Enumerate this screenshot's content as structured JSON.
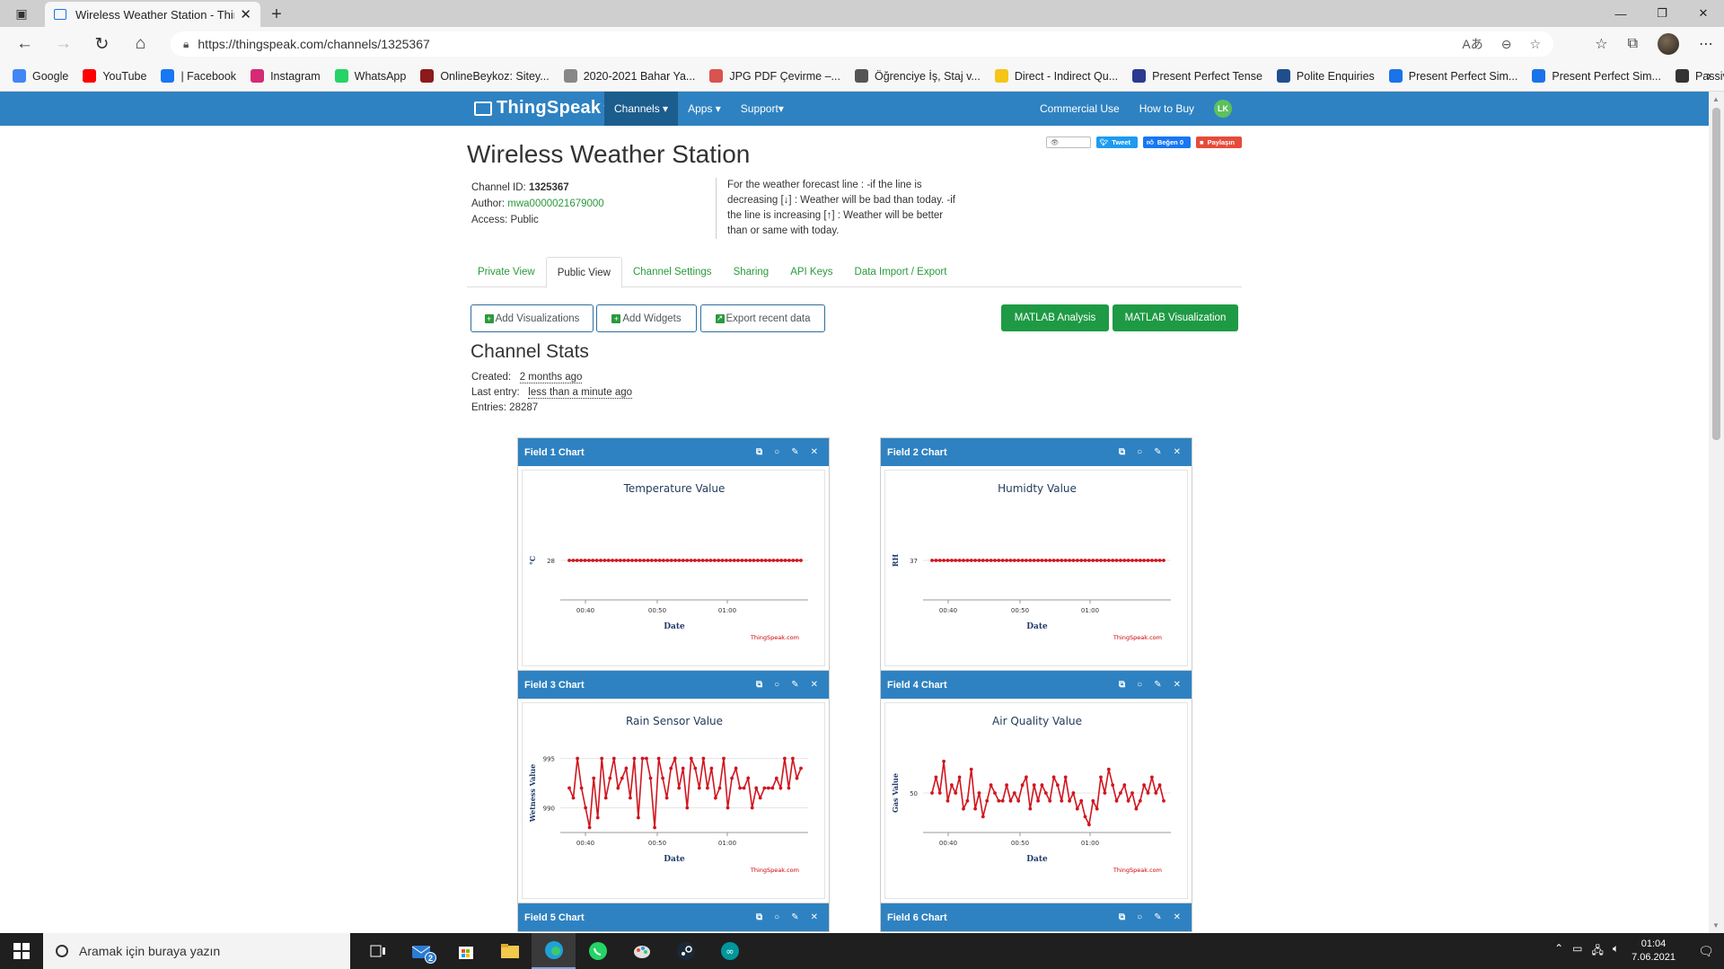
{
  "browser": {
    "tab_title": "Wireless Weather Station - Thing",
    "url": "https://thingspeak.com/channels/1325367",
    "bookmarks": [
      {
        "label": "Google",
        "icon": "google-icon",
        "color": "#4285f4"
      },
      {
        "label": "YouTube",
        "icon": "youtube-icon",
        "color": "#ff0000"
      },
      {
        "label": "| Facebook",
        "icon": "facebook-icon",
        "color": "#1877f2"
      },
      {
        "label": "Instagram",
        "icon": "instagram-icon",
        "color": "#d62976"
      },
      {
        "label": "WhatsApp",
        "icon": "whatsapp-icon",
        "color": "#25d366"
      },
      {
        "label": "OnlineBeykoz: Sitey...",
        "icon": "onlinebeykoz-icon",
        "color": "#8b1a1a"
      },
      {
        "label": "2020-2021 Bahar Ya...",
        "icon": "document-icon",
        "color": "#888888"
      },
      {
        "label": "JPG PDF Çevirme –...",
        "icon": "jpgpdf-icon",
        "color": "#d9534f"
      },
      {
        "label": "Öğrenciye İş, Staj v...",
        "icon": "ogrenci-icon",
        "color": "#555555"
      },
      {
        "label": "Direct - Indirect Qu...",
        "icon": "chat-icon",
        "color": "#f5c518"
      },
      {
        "label": "Present Perfect Tense",
        "icon": "ln-icon",
        "color": "#2b3990"
      },
      {
        "label": "Polite Enquiries",
        "icon": "polite-icon",
        "color": "#1f4e8c"
      },
      {
        "label": "Present Perfect Sim...",
        "icon": "c-icon",
        "color": "#1a73e8"
      },
      {
        "label": "Present Perfect Sim...",
        "icon": "c-icon",
        "color": "#1a73e8"
      },
      {
        "label": "Passive",
        "icon": "passive-icon",
        "color": "#333333"
      }
    ]
  },
  "nav": {
    "logo": "ThingSpeak",
    "tm": "™",
    "menu": [
      "Channels",
      "Apps",
      "Support"
    ],
    "right": [
      "Commercial Use",
      "How to Buy"
    ],
    "avatar": "LK"
  },
  "channel": {
    "title": "Wireless Weather Station",
    "social": [
      "Watch",
      "Tweet",
      "Beğen 0",
      "Paylaşın"
    ],
    "id_label": "Channel ID:",
    "id": "1325367",
    "author_label": "Author:",
    "author": "mwa0000021679000",
    "access": "Access: Public",
    "description": "For the weather forecast line : -if the line is decreasing [↓] : Weather will be bad than today. -if the line is increasing [↑] : Weather will be better than or same with today.",
    "tabs": [
      "Private View",
      "Public View",
      "Channel Settings",
      "Sharing",
      "API Keys",
      "Data Import / Export"
    ],
    "buttons": {
      "add_viz": "Add Visualizations",
      "add_widgets": "Add Widgets",
      "export": "Export recent data",
      "matlab_analysis": "MATLAB Analysis",
      "matlab_viz": "MATLAB Visualization"
    }
  },
  "stats": {
    "heading": "Channel Stats",
    "created_label": "Created:",
    "created": "2 months ago",
    "last_label": "Last entry:",
    "last": "less than a minute ago",
    "entries": "Entries: 28287"
  },
  "cards": [
    {
      "header": "Field 1 Chart"
    },
    {
      "header": "Field 2 Chart"
    },
    {
      "header": "Field 3 Chart"
    },
    {
      "header": "Field 4 Chart"
    },
    {
      "header": "Field 5 Chart"
    },
    {
      "header": "Field 6 Chart"
    }
  ],
  "chart_data": [
    {
      "type": "line",
      "title": "Temperature Value",
      "xlabel": "Date",
      "ylabel": "°C",
      "x_ticks": [
        "00:40",
        "00:50",
        "01:00"
      ],
      "y_ticks": [
        "28"
      ],
      "ylim": [
        27,
        29
      ],
      "credit": "ThingSpeak.com",
      "series": [
        {
          "values": [
            28,
            28,
            28,
            28,
            28,
            28,
            28,
            28,
            28,
            28,
            28,
            28,
            28,
            28,
            28,
            28,
            28,
            28,
            28,
            28,
            28,
            28,
            28,
            28,
            28,
            28,
            28,
            28,
            28,
            28,
            28,
            28,
            28,
            28,
            28,
            28,
            28,
            28,
            28,
            28,
            28,
            28,
            28,
            28,
            28,
            28,
            28,
            28,
            28,
            28,
            28,
            28,
            28,
            28,
            28,
            28,
            28,
            28,
            28,
            28
          ]
        }
      ]
    },
    {
      "type": "line",
      "title": "Humidty Value",
      "xlabel": "Date",
      "ylabel": "RH",
      "x_ticks": [
        "00:40",
        "00:50",
        "01:00"
      ],
      "y_ticks": [
        "37"
      ],
      "ylim": [
        36,
        38
      ],
      "credit": "ThingSpeak.com",
      "series": [
        {
          "values": [
            37,
            37,
            37,
            37,
            37,
            37,
            37,
            37,
            37,
            37,
            37,
            37,
            37,
            37,
            37,
            37,
            37,
            37,
            37,
            37,
            37,
            37,
            37,
            37,
            37,
            37,
            37,
            37,
            37,
            37,
            37,
            37,
            37,
            37,
            37,
            37,
            37,
            37,
            37,
            37,
            37,
            37,
            37,
            37,
            37,
            37,
            37,
            37,
            37,
            37,
            37,
            37,
            37,
            37,
            37,
            37,
            37,
            37,
            37,
            37
          ]
        }
      ]
    },
    {
      "type": "line",
      "title": "Rain Sensor Value",
      "xlabel": "Date",
      "ylabel": "Wetness Value",
      "x_ticks": [
        "00:40",
        "00:50",
        "01:00"
      ],
      "y_ticks": [
        "995",
        "990"
      ],
      "ylim": [
        987.5,
        995.5
      ],
      "credit": "ThingSpeak.com",
      "series": [
        {
          "values": [
            992,
            991,
            995,
            992,
            990,
            988,
            993,
            989,
            995,
            991,
            993,
            995,
            992,
            993,
            994,
            991,
            995,
            989,
            995,
            995,
            993,
            988,
            995,
            993,
            991,
            994,
            995,
            992,
            994,
            990,
            995,
            994,
            992,
            995,
            992,
            994,
            991,
            992,
            995,
            990,
            993,
            994,
            992,
            992,
            993,
            990,
            992,
            991,
            992,
            992,
            992,
            993,
            992,
            995,
            992,
            995,
            993,
            994
          ]
        }
      ]
    },
    {
      "type": "line",
      "title": "Air Quality Value",
      "xlabel": "Date",
      "ylabel": "Gas Value",
      "x_ticks": [
        "00:40",
        "00:50",
        "01:00"
      ],
      "y_ticks": [
        "50"
      ],
      "ylim": [
        45,
        55
      ],
      "credit": "ThingSpeak.com",
      "series": [
        {
          "values": [
            50,
            52,
            50,
            54,
            49,
            51,
            50,
            52,
            48,
            49,
            53,
            48,
            50,
            47,
            49,
            51,
            50,
            49,
            49,
            51,
            49,
            50,
            49,
            51,
            52,
            48,
            51,
            49,
            51,
            50,
            49,
            52,
            51,
            49,
            52,
            49,
            50,
            48,
            49,
            47,
            46,
            49,
            48,
            52,
            50,
            53,
            51,
            49,
            50,
            51,
            49,
            50,
            48,
            49,
            51,
            50,
            52,
            50,
            51,
            49
          ]
        }
      ]
    }
  ],
  "taskbar": {
    "search_placeholder": "Aramak için buraya yazın",
    "mail_badge": "2",
    "time": "01:04",
    "date": "7.06.2021"
  }
}
